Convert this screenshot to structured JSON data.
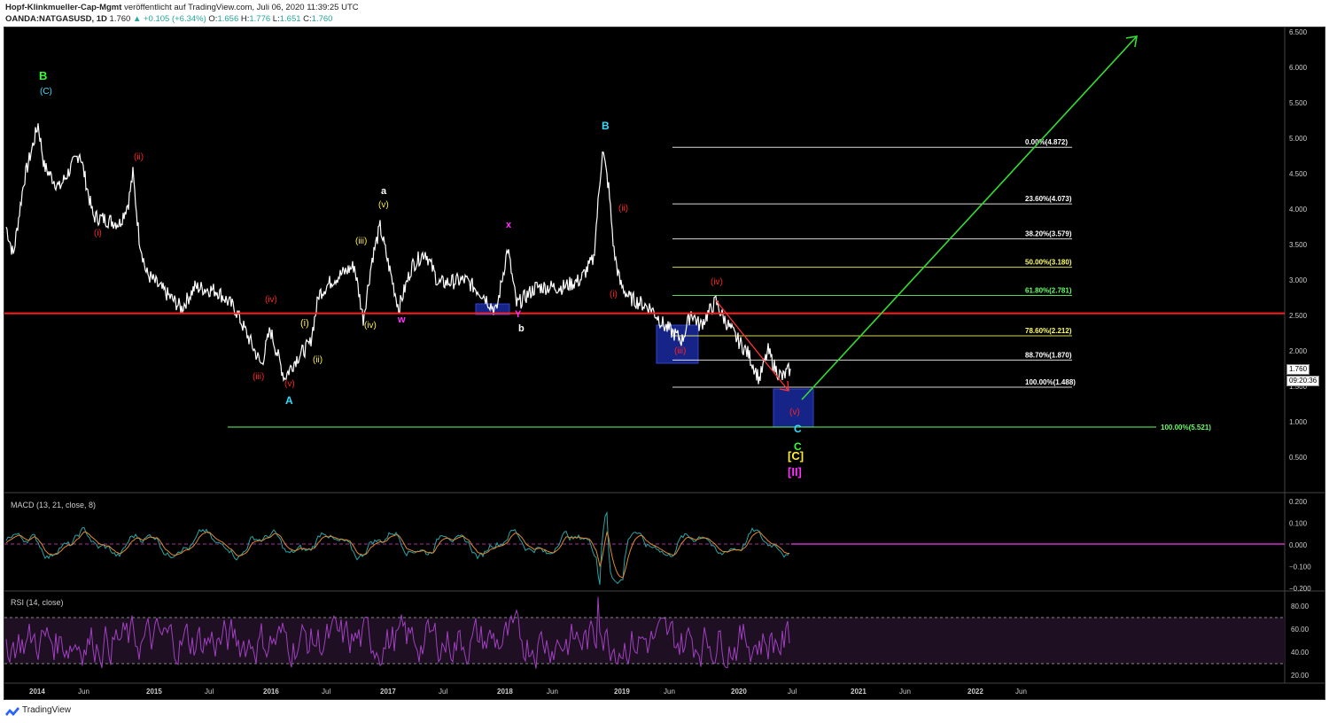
{
  "header": {
    "author": "Hopf-Klinkmueller-Cap-Mgmt",
    "published": "veröffentlicht auf TradingView.com, Juli 06, 2020 11:39:25 UTC",
    "symbol": "OANDA:NATGASUSD, 1D",
    "last": "1.760",
    "change": "▲ +0.105 (+6.34%)",
    "o_label": "O:",
    "o_val": "1.656",
    "h_label": "H:",
    "h_val": "1.776",
    "l_label": "L:",
    "l_val": "1.651",
    "c_label": "C:",
    "c_val": "1.760"
  },
  "price_axis": [
    "6.500",
    "6.000",
    "5.500",
    "5.000",
    "4.500",
    "4.000",
    "3.500",
    "3.000",
    "2.500",
    "2.000",
    "1.500",
    "1.000",
    "0.500"
  ],
  "price_tags": {
    "last": "1.760",
    "countdown": "09:20:36"
  },
  "time_axis": [
    "2014",
    "Jun",
    "2015",
    "Jul",
    "2016",
    "Jul",
    "2017",
    "Jul",
    "2018",
    "Jun",
    "2019",
    "Jun",
    "2020",
    "Jul",
    "2021",
    "Jun",
    "2022",
    "Jun"
  ],
  "fib_levels": [
    {
      "label": "0.00%(4.872)",
      "color": "#ffffff",
      "value": 4.872
    },
    {
      "label": "23.60%(4.073)",
      "color": "#ffffff",
      "value": 4.073
    },
    {
      "label": "38.20%(3.579)",
      "color": "#ffffff",
      "value": 3.579
    },
    {
      "label": "50.00%(3.180)",
      "color": "#ffff66",
      "value": 3.18
    },
    {
      "label": "61.80%(2.781)",
      "color": "#66ff66",
      "value": 2.781
    },
    {
      "label": "78.60%(2.212)",
      "color": "#ffff66",
      "value": 2.212
    },
    {
      "label": "88.70%(1.870)",
      "color": "#ffffff",
      "value": 1.87
    },
    {
      "label": "100.00%(1.488)",
      "color": "#ffffff",
      "value": 1.488
    }
  ],
  "ext_level": {
    "label": "100.00%(5.521)",
    "color": "#66ff66"
  },
  "support_line_value": 2.53,
  "wave_labels": [
    {
      "text": "B",
      "color": "#33ff33"
    },
    {
      "text": "(C)",
      "color": "#33ddff"
    },
    {
      "text": "(ii)",
      "color": "#ff2222"
    },
    {
      "text": "(i)",
      "color": "#ff2222"
    },
    {
      "text": "(iv)",
      "color": "#ff2222"
    },
    {
      "text": "(iii)",
      "color": "#ff2222"
    },
    {
      "text": "(v)",
      "color": "#ff2222"
    },
    {
      "text": "A",
      "color": "#33ddff"
    },
    {
      "text": "(i)",
      "color": "#ffee33"
    },
    {
      "text": "(ii)",
      "color": "#ffee33"
    },
    {
      "text": "(iii)",
      "color": "#ffee33"
    },
    {
      "text": "(iv)",
      "color": "#ffee33"
    },
    {
      "text": "(v)",
      "color": "#ffee33"
    },
    {
      "text": "a",
      "color": "#ffffff"
    },
    {
      "text": "w",
      "color": "#ff33ff"
    },
    {
      "text": "x",
      "color": "#ff33ff"
    },
    {
      "text": "Y",
      "color": "#ff33ff"
    },
    {
      "text": "b",
      "color": "#ffffff"
    },
    {
      "text": "B",
      "color": "#33ddff"
    },
    {
      "text": "(ii)",
      "color": "#ff2222"
    },
    {
      "text": "(i)",
      "color": "#ff2222"
    },
    {
      "text": "(iii)",
      "color": "#ff2222"
    },
    {
      "text": "(iv)",
      "color": "#ff2222"
    },
    {
      "text": "(v)",
      "color": "#ff2222"
    },
    {
      "text": "C",
      "color": "#33ddff"
    },
    {
      "text": "C",
      "color": "#33ff33"
    },
    {
      "text": "[C]",
      "color": "#ffee33"
    },
    {
      "text": "[II]",
      "color": "#ff33ff"
    }
  ],
  "macd": {
    "title": "MACD (13, 21, close, 8)",
    "axis": [
      "0.200",
      "0.100",
      "0.000",
      "−0.100",
      "−0.200"
    ]
  },
  "rsi": {
    "title": "RSI (14, close)",
    "axis": [
      "80.00",
      "60.00",
      "40.00",
      "20.00"
    ]
  },
  "footer": {
    "brand": "TradingView"
  },
  "colors": {
    "price": "#ffffff",
    "support": "#ff2020",
    "projection": "#33dd33",
    "macd": "#2ba5a5",
    "signal": "#e08830",
    "rsi": "#a040c0",
    "box": "#1a2aa0"
  }
}
